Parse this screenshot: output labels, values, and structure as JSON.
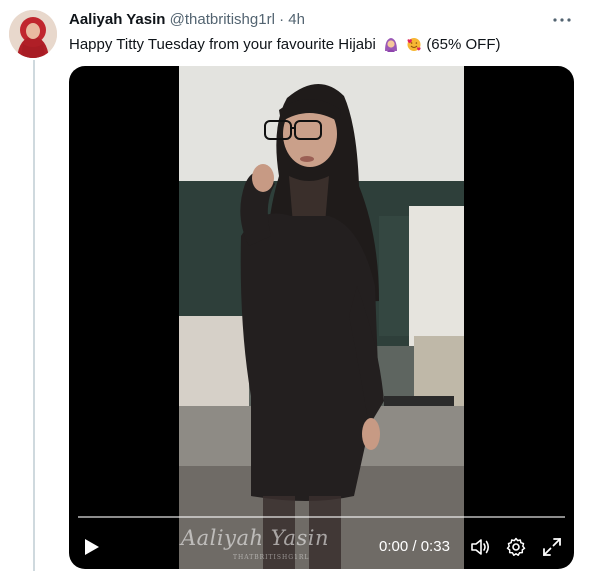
{
  "tweet": {
    "author_name": "Aaliyah Yasin",
    "handle": "@thatbritishg1rl",
    "separator": "·",
    "time": "4h",
    "text_before_emoji": "Happy Titty Tuesday from your favourite Hijabi",
    "emojis": [
      "person-with-headscarf-emoji",
      "smiling-face-with-hearts-emoji"
    ],
    "text_after_emoji": "(65% OFF)"
  },
  "video": {
    "current_time": "0:00",
    "time_separator": "/",
    "duration": "0:33",
    "progress": 0,
    "watermark_name": "Aaliyah Yasin",
    "watermark_handle": "THATBRITISHG1RL"
  },
  "icons": {
    "more": "more-horizontal-icon",
    "play": "play-icon",
    "volume": "volume-icon",
    "settings": "settings-gear-icon",
    "fullscreen": "fullscreen-expand-icon"
  },
  "colors": {
    "text_primary": "#0f1419",
    "text_secondary": "#536471",
    "thread_line": "#cfd9de",
    "video_bg": "#000000"
  }
}
